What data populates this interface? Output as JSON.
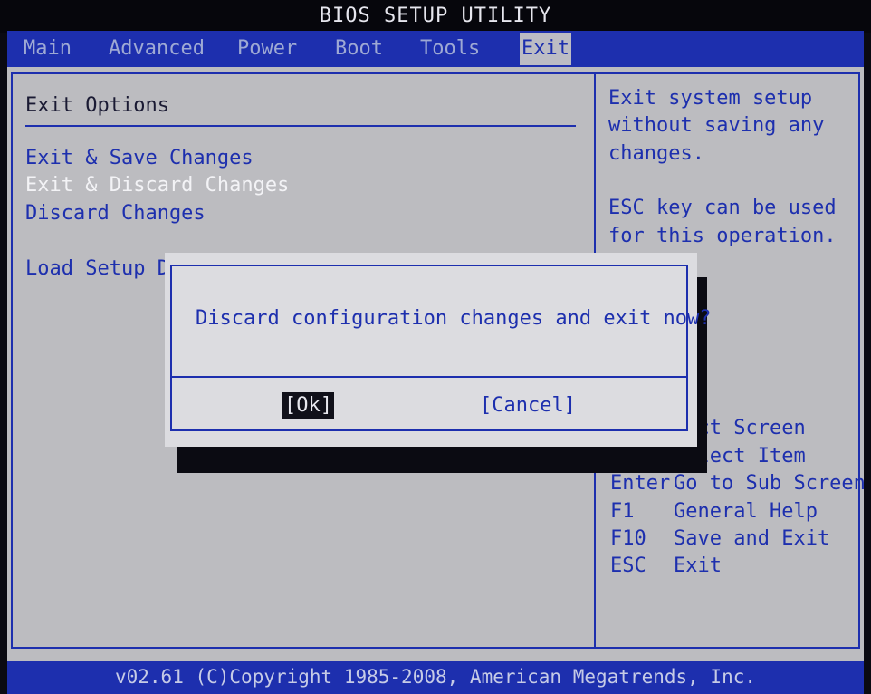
{
  "title": "BIOS SETUP UTILITY",
  "menu": [
    {
      "label": "Main",
      "active": false
    },
    {
      "label": "Advanced",
      "active": false
    },
    {
      "label": "Power",
      "active": false
    },
    {
      "label": "Boot",
      "active": false
    },
    {
      "label": "Tools",
      "active": false
    },
    {
      "label": "Exit",
      "active": true
    }
  ],
  "exit_options": {
    "title": "Exit Options",
    "items": [
      "Exit & Save Changes",
      "Exit & Discard Changes",
      "Discard Changes",
      "Load Setup De"
    ],
    "selected_index": 1
  },
  "help": {
    "description": [
      "Exit system setup",
      "without saving any",
      "changes."
    ],
    "note": [
      "ESC key can be used",
      "for this operation."
    ],
    "keys": [
      {
        "key": "",
        "action": "lect Screen"
      },
      {
        "key": "↑↓",
        "action": "Select Item"
      },
      {
        "key": "Enter",
        "action": "Go to Sub Screen"
      },
      {
        "key": "F1",
        "action": "General Help"
      },
      {
        "key": "F10",
        "action": "Save and Exit"
      },
      {
        "key": "ESC",
        "action": "Exit"
      }
    ]
  },
  "dialog": {
    "message": "Discard configuration changes and exit now?",
    "ok_label": "[Ok]",
    "cancel_label": "[Cancel]"
  },
  "footer": "v02.61 (C)Copyright 1985-2008, American Megatrends, Inc.",
  "colors": {
    "bios_blue": "#1d2fae",
    "panel_gray": "#bcbcc0",
    "dialog_gray": "#dcdce0"
  }
}
